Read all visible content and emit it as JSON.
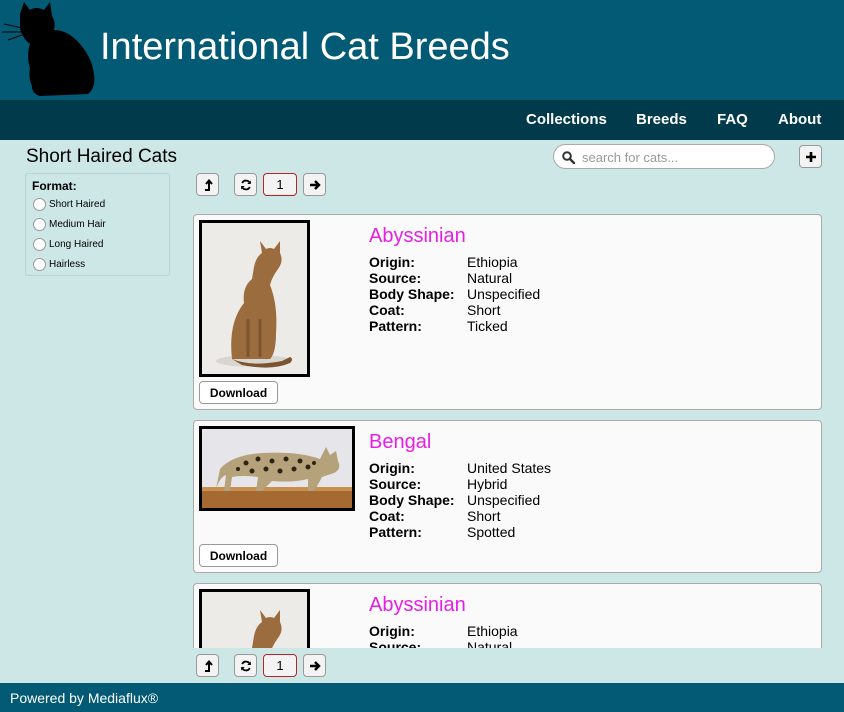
{
  "header": {
    "title": "International Cat Breeds",
    "logo_icon": "cat-silhouette-icon"
  },
  "nav": {
    "items": [
      {
        "label": "Collections"
      },
      {
        "label": "Breeds"
      },
      {
        "label": "FAQ"
      },
      {
        "label": "About"
      }
    ]
  },
  "page": {
    "heading": "Short Haired Cats"
  },
  "search": {
    "placeholder": "search for cats...",
    "value": "",
    "icon": "search-icon"
  },
  "add_button": {
    "icon": "plus-icon"
  },
  "pager": {
    "page": "1",
    "icons": [
      "up-level-icon",
      "refresh-icon",
      "arrow-right-icon"
    ]
  },
  "filter": {
    "title": "Format:",
    "options": [
      {
        "label": "Short Haired"
      },
      {
        "label": "Medium Hair"
      },
      {
        "label": "Long Haired"
      },
      {
        "label": "Hairless"
      }
    ]
  },
  "results": [
    {
      "name": "Abyssinian",
      "attributes": [
        {
          "label": "Origin:",
          "value": "Ethiopia"
        },
        {
          "label": "Source:",
          "value": "Natural"
        },
        {
          "label": "Body Shape:",
          "value": "Unspecified"
        },
        {
          "label": "Coat:",
          "value": "Short"
        },
        {
          "label": "Pattern:",
          "value": "Ticked"
        }
      ],
      "download_label": "Download"
    },
    {
      "name": "Bengal",
      "attributes": [
        {
          "label": "Origin:",
          "value": "United States"
        },
        {
          "label": "Source:",
          "value": "Hybrid"
        },
        {
          "label": "Body Shape:",
          "value": "Unspecified"
        },
        {
          "label": "Coat:",
          "value": "Short"
        },
        {
          "label": "Pattern:",
          "value": "Spotted"
        }
      ],
      "download_label": "Download"
    },
    {
      "name": "Abyssinian",
      "attributes": [
        {
          "label": "Origin:",
          "value": "Ethiopia"
        },
        {
          "label": "Source:",
          "value": "Natural"
        }
      ]
    }
  ],
  "footer": {
    "text": "Powered by Mediaflux®"
  },
  "colors": {
    "header": "#025a74",
    "nav": "#013a4b",
    "background": "#cde6e6",
    "breed_name": "#e81ee6",
    "page_border": "#b22222"
  }
}
